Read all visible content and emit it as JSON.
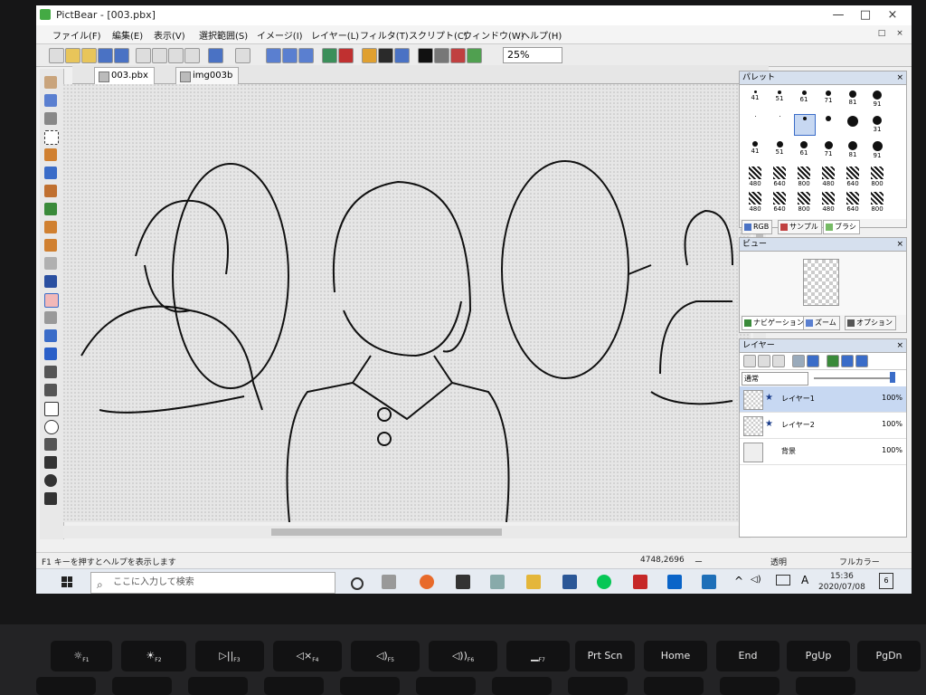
{
  "window": {
    "title": "PictBear - [003.pbx]",
    "min": "—",
    "max": "□",
    "close": "×",
    "doc_restore": "□",
    "doc_close": "×"
  },
  "menu": [
    "ファイル(F)",
    "編集(E)",
    "表示(V)",
    "選択範囲(S)",
    "イメージ(I)",
    "レイヤー(L)",
    "フィルタ(T)",
    "スクリプト(C)",
    "ウィンドウ(W)",
    "ヘルプ(H)"
  ],
  "toolbar": {
    "zoom": "25%"
  },
  "tabs": [
    "003.pbx",
    "img003b"
  ],
  "palette": {
    "title": "パレット",
    "brushes": [
      "41",
      "51",
      "61",
      "71",
      "81",
      "91",
      "",
      "",
      "",
      "",
      "",
      "31",
      "41",
      "51",
      "61",
      "71",
      "81",
      "91",
      "480",
      "640",
      "800",
      "480",
      "640",
      "800",
      "480",
      "640",
      "800",
      "480",
      "640",
      "800"
    ],
    "tabs": [
      "RGB",
      "サンプル",
      "ブラシ"
    ]
  },
  "view": {
    "title": "ビュー",
    "tabs": [
      "ナビゲーション",
      "ズーム",
      "オプション"
    ]
  },
  "layers": {
    "title": "レイヤー",
    "blend_mode": "通常",
    "rows": [
      {
        "name": "レイヤー1",
        "opacity": "100%"
      },
      {
        "name": "レイヤー2",
        "opacity": "100%"
      },
      {
        "name": "背景",
        "opacity": "100%"
      }
    ]
  },
  "status": {
    "help": "F1 キーを押すとヘルプを表示します",
    "coords": "4748,2696",
    "coords_extra": "ー",
    "transparency": "透明",
    "color_mode": "フルカラー"
  },
  "taskbar": {
    "search_placeholder": "ここに入力して検索",
    "time": "15:36",
    "date": "2020/07/08",
    "ime": "A",
    "notif": "6"
  },
  "keyboard": {
    "keys": [
      "F1",
      "F2",
      "F3",
      "F4",
      "F5",
      "F6",
      "F7",
      "Prt Scn",
      "Home",
      "End",
      "PgUp",
      "PgDn"
    ]
  }
}
